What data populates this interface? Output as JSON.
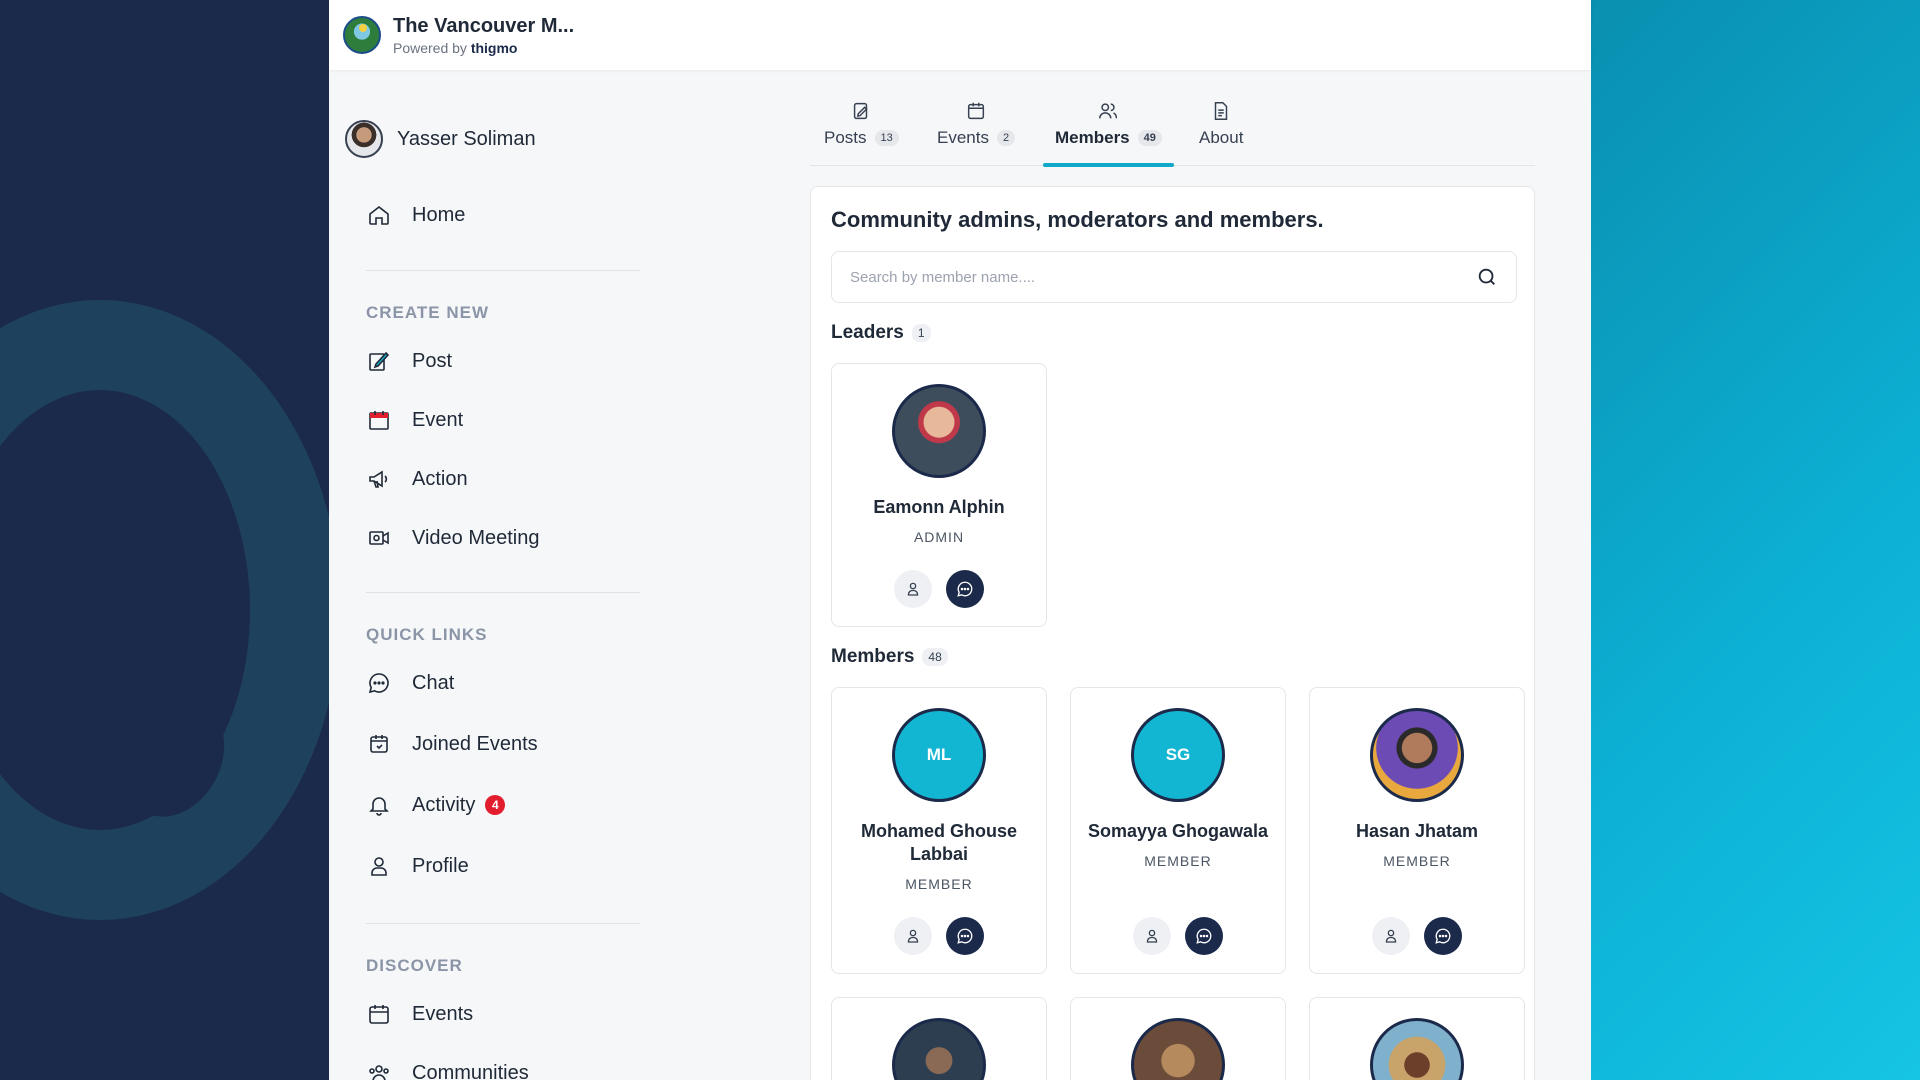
{
  "brand": {
    "title": "The Vancouver M...",
    "powered_prefix": "Powered by",
    "powered_name": "thigmo"
  },
  "user": {
    "name": "Yasser Soliman"
  },
  "nav": {
    "home": "Home",
    "create_new_label": "CREATE NEW",
    "create_items": [
      "Post",
      "Event",
      "Action",
      "Video Meeting"
    ],
    "quick_links_label": "QUICK LINKS",
    "quick_items": [
      "Chat",
      "Joined Events",
      "Activity",
      "Profile"
    ],
    "activity_badge": "4",
    "discover_label": "DISCOVER",
    "discover_items": [
      "Events",
      "Communities"
    ]
  },
  "tabs": [
    {
      "label": "Posts",
      "count": "13",
      "icon": "edit-icon"
    },
    {
      "label": "Events",
      "count": "2",
      "icon": "calendar-icon"
    },
    {
      "label": "Members",
      "count": "49",
      "icon": "users-icon",
      "active": true
    },
    {
      "label": "About",
      "count": "",
      "icon": "document-icon"
    }
  ],
  "panel": {
    "title": "Community admins, moderators and members.",
    "search_placeholder": "Search by member name....",
    "leaders_label": "Leaders",
    "leaders_count": "1",
    "members_label": "Members",
    "members_count": "48"
  },
  "leaders": [
    {
      "name": "Eamonn Alphin",
      "role": "ADMIN",
      "avatar": "photo"
    }
  ],
  "members": [
    {
      "name": "Mohamed Ghouse Labbai",
      "role": "MEMBER",
      "initials": "ML"
    },
    {
      "name": "Somayya Ghogawala",
      "role": "MEMBER",
      "initials": "SG"
    },
    {
      "name": "Hasan Jhatam",
      "role": "MEMBER",
      "avatar": "photo"
    }
  ],
  "colors": {
    "accent": "#10a9c9",
    "navy": "#1b2a4a",
    "initials_bg": "#13b6d2",
    "badge_red": "#e11d2e"
  }
}
